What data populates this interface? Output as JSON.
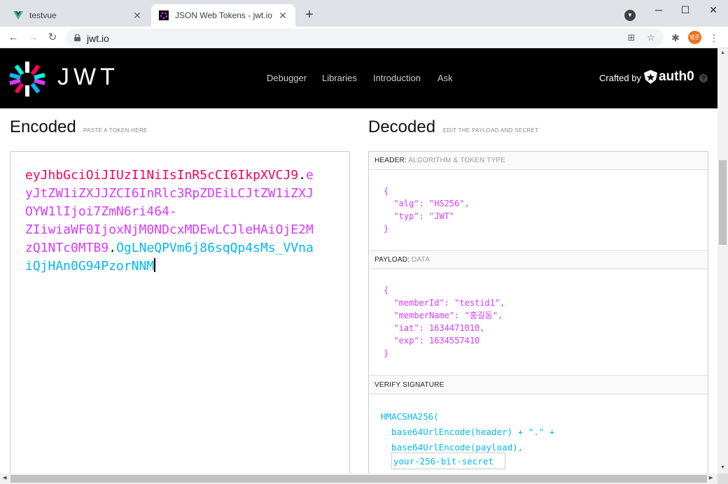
{
  "browser": {
    "tabs": [
      {
        "title": "testvue",
        "favicon": "vue-icon"
      },
      {
        "title": "JSON Web Tokens - jwt.io",
        "favicon": "jwt-icon"
      }
    ],
    "new_tab_label": "+",
    "url": "jwt.io",
    "profile_initials": "병준",
    "window_controls": {
      "minimize": "─",
      "maximize": "☐",
      "close": "✕"
    }
  },
  "site": {
    "logo_text": "JWT",
    "nav": [
      "Debugger",
      "Libraries",
      "Introduction",
      "Ask"
    ],
    "crafted_by": "Crafted by",
    "auth0": "auth0",
    "help": "?"
  },
  "encoded": {
    "title": "Encoded",
    "subtitle": "PASTE A TOKEN HERE",
    "lines": [
      [
        {
          "t": "eyJhbGciOiJIUzI1NiIsInR5cCI6IkpXVCJ9",
          "c": "head"
        },
        {
          "t": ".",
          "c": "dot"
        },
        {
          "t": "e",
          "c": "pay"
        }
      ],
      [
        {
          "t": "yJtZW1iZXJJZCI6InRlc3RpZDEiLCJtZW1iZXJ",
          "c": "pay"
        }
      ],
      [
        {
          "t": "OYW1lIjoi7ZmN6ri464-",
          "c": "pay"
        }
      ],
      [
        {
          "t": "ZIiwiaWF0IjoxNjM0NDcxMDEwLCJleHAiOjE2M",
          "c": "pay"
        }
      ],
      [
        {
          "t": "zQ1NTc0MTB9",
          "c": "pay"
        },
        {
          "t": ".",
          "c": "dot"
        },
        {
          "t": "OgLNeQPVm6j86sqQp4sMs_VVna",
          "c": "sig"
        }
      ],
      [
        {
          "t": "iQjHAn0G94PzorNNM",
          "c": "sig"
        }
      ]
    ]
  },
  "decoded": {
    "title": "Decoded",
    "subtitle": "EDIT THE PAYLOAD AND SECRET",
    "header_section": {
      "label": "HEADER:",
      "sublabel": "ALGORITHM & TOKEN TYPE"
    },
    "header_json": "{\n  \"alg\": \"HS256\",\n  \"typ\": \"JWT\"\n}",
    "payload_section": {
      "label": "PAYLOAD:",
      "sublabel": "DATA"
    },
    "payload_json": "{\n  \"memberId\": \"testid1\",\n  \"memberName\": \"홍길동\",\n  \"iat\": 1634471010,\n  \"exp\": 1634557410\n}",
    "signature_section": {
      "label": "VERIFY SIGNATURE"
    },
    "signature_code": "HMACSHA256(\n  base64UrlEncode(header) + \".\" +\n  base64UrlEncode(payload),",
    "secret_value": "your-256-bit-secret"
  },
  "colors": {
    "header": "#fb015b",
    "payload": "#d63aff",
    "signature": "#00b9f1"
  }
}
